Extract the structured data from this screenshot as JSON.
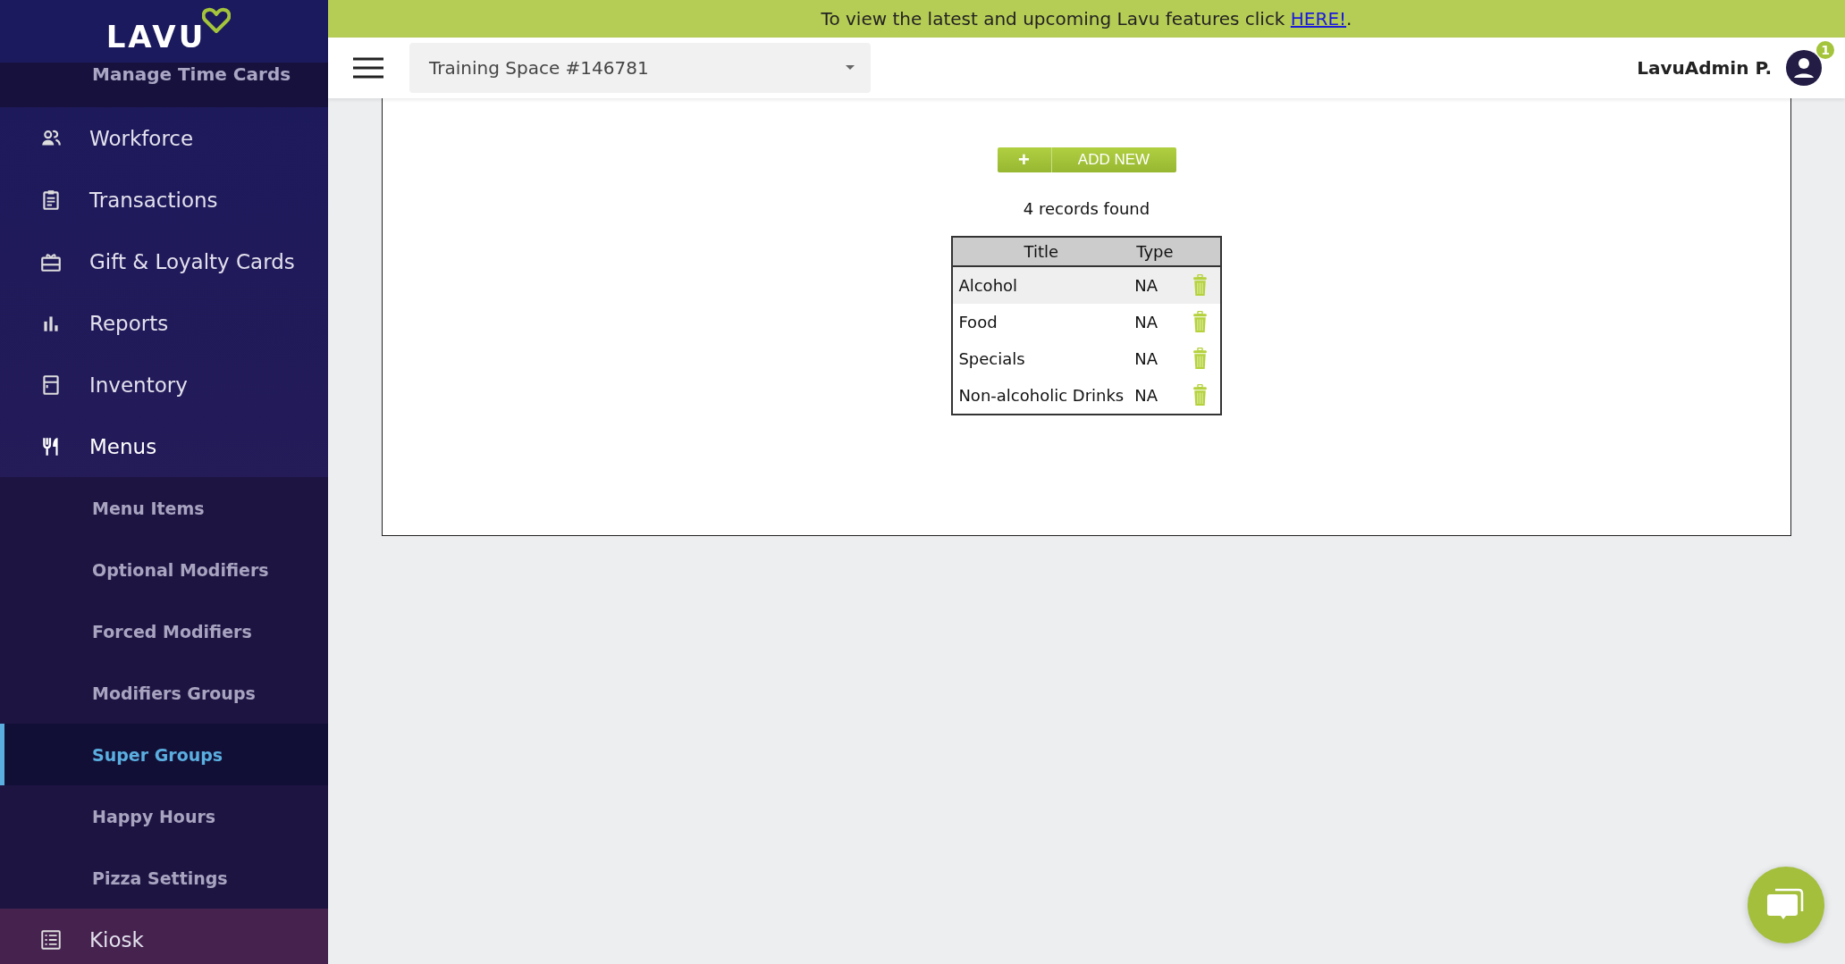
{
  "banner": {
    "text": "To view the latest and upcoming Lavu features click ",
    "link": "HERE!",
    "end": "."
  },
  "sidebar": {
    "logo": "LAVU",
    "partial_item": "Manage Time Cards",
    "items": [
      {
        "label": "Workforce",
        "expanded": false
      },
      {
        "label": "Transactions",
        "expanded": false
      },
      {
        "label": "Gift & Loyalty Cards",
        "expanded": false
      },
      {
        "label": "Reports",
        "expanded": false
      },
      {
        "label": "Inventory",
        "expanded": false
      },
      {
        "label": "Menus",
        "expanded": true,
        "children": [
          {
            "label": "Menu Items",
            "selected": false
          },
          {
            "label": "Optional Modifiers",
            "selected": false
          },
          {
            "label": "Forced Modifiers",
            "selected": false
          },
          {
            "label": "Modifiers Groups",
            "selected": false
          },
          {
            "label": "Super Groups",
            "selected": true
          },
          {
            "label": "Happy Hours",
            "selected": false
          },
          {
            "label": "Pizza Settings",
            "selected": false
          }
        ]
      },
      {
        "label": "Kiosk",
        "expanded": false
      }
    ]
  },
  "header": {
    "location": "Training Space #146781",
    "user": "LavuAdmin P.",
    "notification_count": "1"
  },
  "content": {
    "add_button": {
      "icon": "+",
      "label": "ADD NEW"
    },
    "records": "4 records found",
    "table": {
      "columns": [
        "Title",
        "Type"
      ],
      "rows": [
        {
          "title": "Alcohol",
          "type": "NA",
          "highlighted": true
        },
        {
          "title": "Food",
          "type": "NA",
          "highlighted": false
        },
        {
          "title": "Specials",
          "type": "NA",
          "highlighted": false
        },
        {
          "title": "Non-alcoholic Drinks",
          "type": "NA",
          "highlighted": false
        }
      ]
    }
  }
}
